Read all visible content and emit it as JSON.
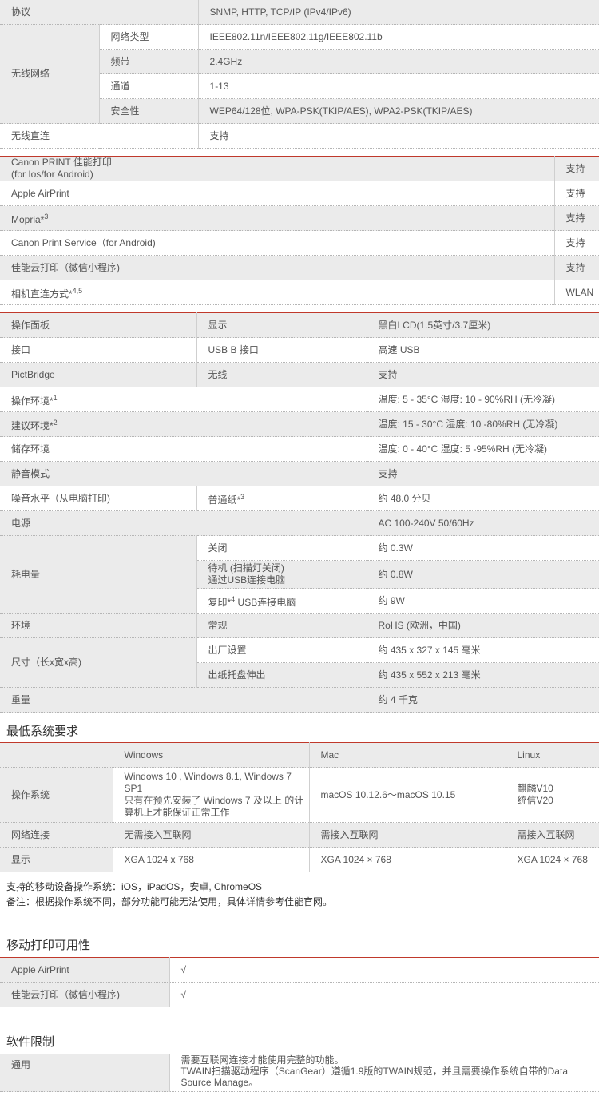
{
  "network": {
    "protocol": {
      "label": "协议",
      "value": "SNMP, HTTP, TCP/IP (IPv4/IPv6)"
    },
    "wireless": {
      "label": "无线网络",
      "rows": [
        {
          "k": "网络类型",
          "v": "IEEE802.11n/IEEE802.11g/IEEE802.11b"
        },
        {
          "k": "频带",
          "v": "2.4GHz"
        },
        {
          "k": "通道",
          "v": "1-13"
        },
        {
          "k": "安全性",
          "v": "WEP64/128位, WPA-PSK(TKIP/AES), WPA2-PSK(TKIP/AES)"
        }
      ]
    },
    "direct": {
      "label": "无线直连",
      "value": "支持"
    }
  },
  "mobile": [
    {
      "k": "Canon PRINT 佳能打印",
      "k2": " (for Ios/for Android)",
      "v": "支持"
    },
    {
      "k": "Apple AirPrint",
      "v": "支持"
    },
    {
      "k": "Mopria*",
      "sup": "3",
      "v": "支持"
    },
    {
      "k": "Canon Print Service（for Android)",
      "v": "支持"
    },
    {
      "k": "佳能云打印（微信小程序)",
      "v": "支持"
    },
    {
      "k": "相机直连方式*",
      "sup": "4,5",
      "v": "WLAN"
    }
  ],
  "general": {
    "panel": {
      "k": "操作面板",
      "k2": "显示",
      "v": "黑白LCD(1.5英寸/3.7厘米)"
    },
    "iface": {
      "k": "接口",
      "k2": "USB B 接口",
      "v": "高速 USB"
    },
    "pict": {
      "k": "PictBridge",
      "k2": "无线",
      "v": "支持"
    },
    "openv": {
      "k": "操作环境*",
      "sup": "1",
      "v": "温度: 5 - 35°C    湿度: 10 - 90%RH (无冷凝)"
    },
    "recenv": {
      "k": "建议环境*",
      "sup": "2",
      "v": "温度: 15 - 30°C    湿度: 10 -80%RH  (无冷凝)"
    },
    "store": {
      "k": "储存环境",
      "v": "温度: 0 - 40°C    湿度: 5 -95%RH  (无冷凝)"
    },
    "quiet": {
      "k": "静音模式",
      "v": "支持"
    },
    "noise": {
      "k": "噪音水平（从电脑打印)",
      "k2": "普通纸*",
      "sup": "3",
      "v": "约 48.0 分贝"
    },
    "power": {
      "k": "电源",
      "v": "AC 100-240V 50/60Hz"
    },
    "consumption": {
      "label": "耗电量",
      "rows": [
        {
          "k": "关闭",
          "v": "约 0.3W"
        },
        {
          "k": "待机 (扫描灯关闭)",
          "k_line2": "通过USB连接电脑",
          "v": "约 0.8W"
        },
        {
          "k": "复印*",
          "sup": "4",
          "k_rest": " USB连接电脑",
          "v": "约 9W"
        }
      ]
    },
    "envir": {
      "k": "环境",
      "k2": "常规",
      "v": "RoHS (欧洲，中国)"
    },
    "size": {
      "label": "尺寸（长x宽x高)",
      "rows": [
        {
          "k": "出厂设置",
          "v": "约 435 x 327 x 145 毫米"
        },
        {
          "k": "出纸托盘伸出",
          "v": "约 435 x 552 x 213 毫米"
        }
      ]
    },
    "weight": {
      "k": "重量",
      "v": "约 4 千克"
    }
  },
  "sysreq": {
    "title": "最低系统要求",
    "headers": [
      "Windows",
      "Mac",
      "Linux"
    ],
    "os": {
      "k": "操作系统",
      "win1": "Windows 10 , Windows 8.1, Windows 7",
      "win2": "SP1",
      "win3": "只有在预先安装了 Windows 7 及以上 的计",
      "win4": "算机上才能保证正常工作",
      "mac": "macOS 10.12.6～macOS 10.15",
      "linux1": "麒麟V10",
      "linux2": "统信V20"
    },
    "net": {
      "k": "网络连接",
      "win": "无需接入互联网",
      "mac": "需接入互联网",
      "linux": "需接入互联网"
    },
    "disp": {
      "k": "显示",
      "win": "XGA 1024 x 768",
      "mac": "XGA 1024 × 768",
      "linux": "XGA 1024 × 768"
    },
    "note1": "支持的移动设备操作系统：iOS，iPadOS，安卓, ChromeOS",
    "note2": "备注：根据操作系统不同，部分功能可能无法使用，具体详情参考佳能官网。"
  },
  "mobileavail": {
    "title": "移动打印可用性",
    "rows": [
      {
        "k": "Apple AirPrint",
        "v": "√"
      },
      {
        "k": "佳能云打印（微信小程序)",
        "v": "√"
      }
    ]
  },
  "software": {
    "title": "软件限制",
    "k": "通用",
    "l1": "需要互联网连接才能使用完整的功能。",
    "l2": "TWAIN扫描驱动程序（ScanGear）遵循1.9版的TWAIN规范，并且需要操作系统自带的Data",
    "l3": "Source Manage。"
  }
}
